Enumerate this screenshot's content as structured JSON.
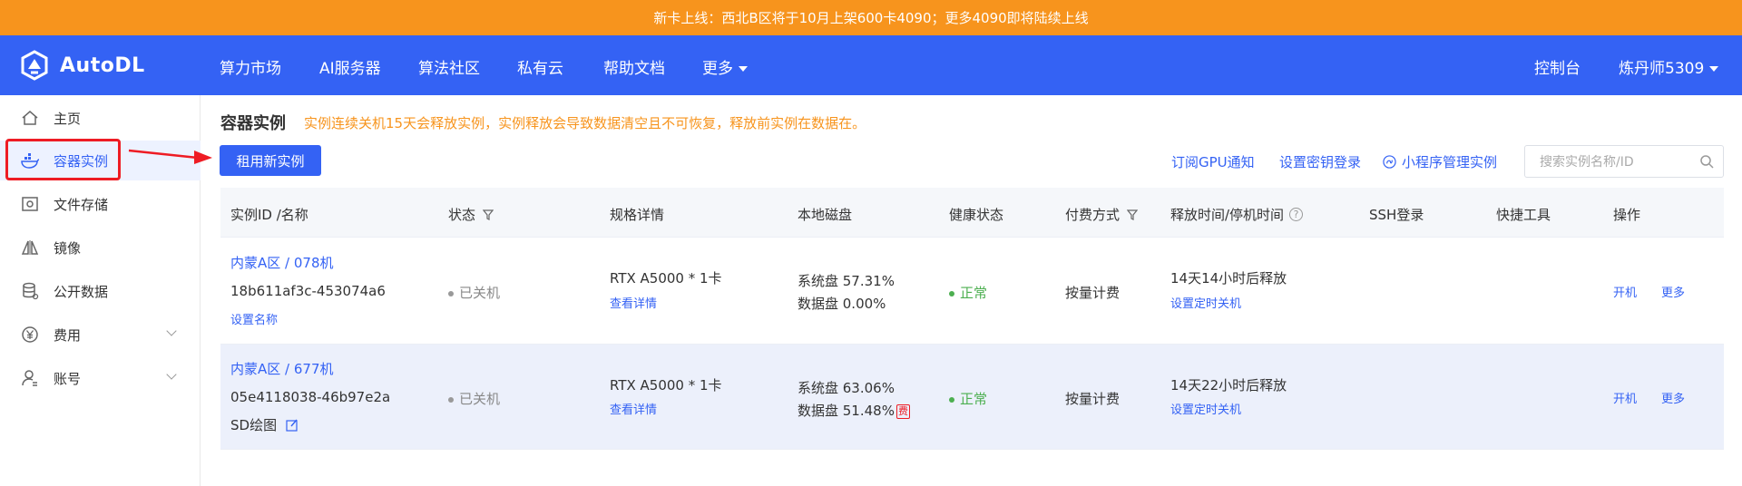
{
  "banner": {
    "text": "新卡上线：西北B区将于10月上架600卡4090；更多4090即将陆续上线"
  },
  "brand": {
    "name": "AutoDL",
    "color": "#3462f4",
    "banner_color": "#f7941d"
  },
  "nav": {
    "items": [
      "算力市场",
      "AI服务器",
      "算法社区",
      "私有云",
      "帮助文档",
      "更多"
    ],
    "console": "控制台",
    "user": "炼丹师5309"
  },
  "sidebar": {
    "items": [
      {
        "label": "主页",
        "icon": "home-icon"
      },
      {
        "label": "容器实例",
        "icon": "container-icon"
      },
      {
        "label": "文件存储",
        "icon": "storage-icon"
      },
      {
        "label": "镜像",
        "icon": "image-icon"
      },
      {
        "label": "公开数据",
        "icon": "database-icon"
      },
      {
        "label": "费用",
        "icon": "yen-icon"
      },
      {
        "label": "账号",
        "icon": "user-icon"
      }
    ]
  },
  "main": {
    "title": "容器实例",
    "warning": "实例连续关机15天会释放实例，实例释放会导致数据清空且不可恢复，释放前实例在数据在。",
    "new_button": "租用新实例",
    "links": {
      "gpu_notify": "订阅GPU通知",
      "key_login": "设置密钥登录",
      "mini_program": "小程序管理实例"
    },
    "search_placeholder": "搜索实例名称/ID"
  },
  "table": {
    "headers": [
      "实例ID /名称",
      "状态",
      "规格详情",
      "本地磁盘",
      "健康状态",
      "付费方式",
      "释放时间/停机时间",
      "SSH登录",
      "快捷工具",
      "操作"
    ],
    "rows": [
      {
        "region": "内蒙A区 / 078机",
        "id": "18b611af3c-453074a6",
        "name": "设置名称",
        "status": "已关机",
        "spec": "RTX A5000 * 1卡",
        "spec_link": "查看详情",
        "disk_system": "系统盘 57.31%",
        "disk_data": "数据盘 0.00%",
        "health": "正常",
        "billing": "按量计费",
        "release": "14天14小时后释放",
        "release_link": "设置定时关机",
        "action_start": "开机",
        "action_more": "更多"
      },
      {
        "region": "内蒙A区 / 677机",
        "id": "05e4118038-46b97e2a",
        "name": "SD绘图",
        "status": "已关机",
        "spec": "RTX A5000 * 1卡",
        "spec_link": "查看详情",
        "disk_system": "系统盘 63.06%",
        "disk_data": "数据盘 51.48%",
        "fee_badge": "费",
        "health": "正常",
        "billing": "按量计费",
        "release": "14天22小时后释放",
        "release_link": "设置定时关机",
        "action_start": "开机",
        "action_more": "更多"
      }
    ]
  }
}
